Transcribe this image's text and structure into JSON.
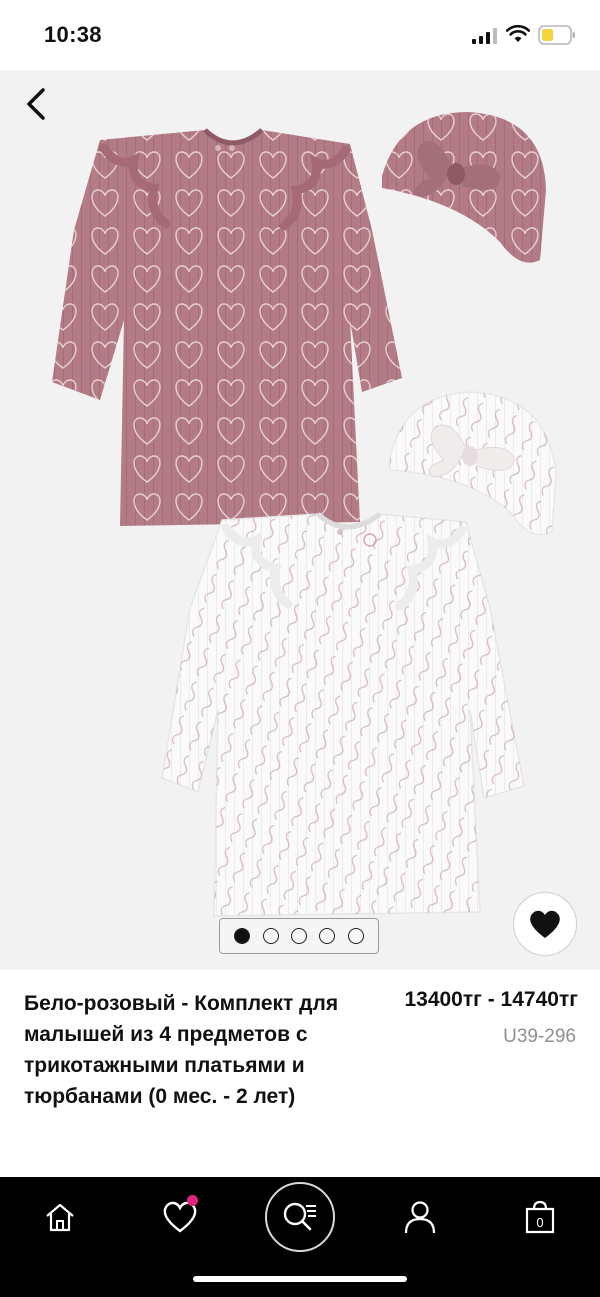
{
  "status_bar": {
    "time": "10:38",
    "battery_color": "#f5d33b"
  },
  "gallery": {
    "background": "#f2f2f2",
    "image_count": 5,
    "active_index": 0,
    "back_icon": "chevron-left-icon",
    "favorite_icon": "heart-icon"
  },
  "product": {
    "title": "Бело-розовый - Комплект для малышей из 4 предметов с трикотажными платьями и тюрбанами (0 мес. - 2 лет)",
    "price": "13400тг - 14740тг",
    "sku": "U39-296"
  },
  "tabbar": {
    "background": "#000000",
    "items": [
      {
        "icon": "home-icon"
      },
      {
        "icon": "heart-icon",
        "has_badge": true,
        "badge_color": "#e0267a"
      },
      {
        "icon": "search-list-icon"
      },
      {
        "icon": "user-icon"
      },
      {
        "icon": "bag-icon",
        "count": "0"
      }
    ]
  }
}
